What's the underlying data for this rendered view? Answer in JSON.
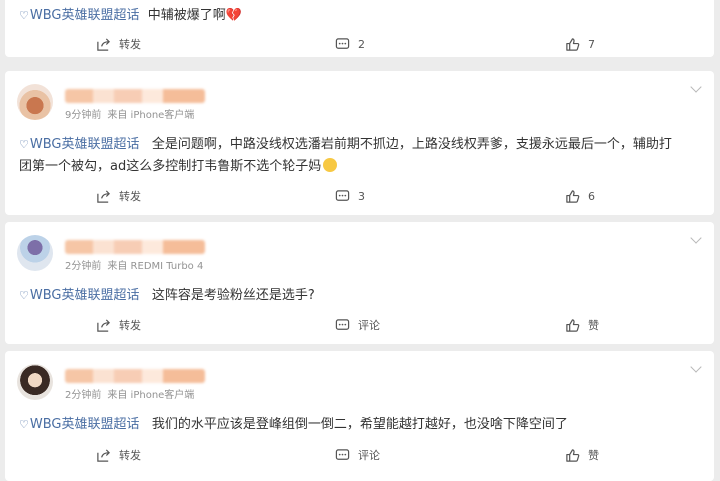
{
  "tag_label": "WBG英雄联盟超话",
  "actions": {
    "share_label": "转发",
    "comment_label": "评论",
    "like_label": "赞"
  },
  "posts": [
    {
      "text": "中辅被爆了啊",
      "emoji": "broken-heart",
      "comments": "2",
      "likes": "7"
    },
    {
      "time": "9分钟前",
      "source": "来自 iPhone客户端",
      "text": "全是问题啊，中路没线权选潘岩前期不抓边，上路没线权弄爹，支援永远最后一个，辅助打团第一个被勾，ad这么多控制打韦鲁斯不选个轮子妈",
      "emoji": "crying-face",
      "comments": "3",
      "likes": "6"
    },
    {
      "time": "2分钟前",
      "source": "来自 REDMI Turbo 4",
      "text": "这阵容是考验粉丝还是选手?",
      "comments": "",
      "likes": ""
    },
    {
      "time": "2分钟前",
      "source": "来自 iPhone客户端",
      "text": "我们的水平应该是登峰组倒一倒二，希望能越打越好，也没啥下降空间了",
      "comments": "",
      "likes": ""
    }
  ],
  "colors": {
    "tag": "#4a6ea3",
    "meta": "#939393",
    "background": "#ececec",
    "card": "#ffffff"
  }
}
